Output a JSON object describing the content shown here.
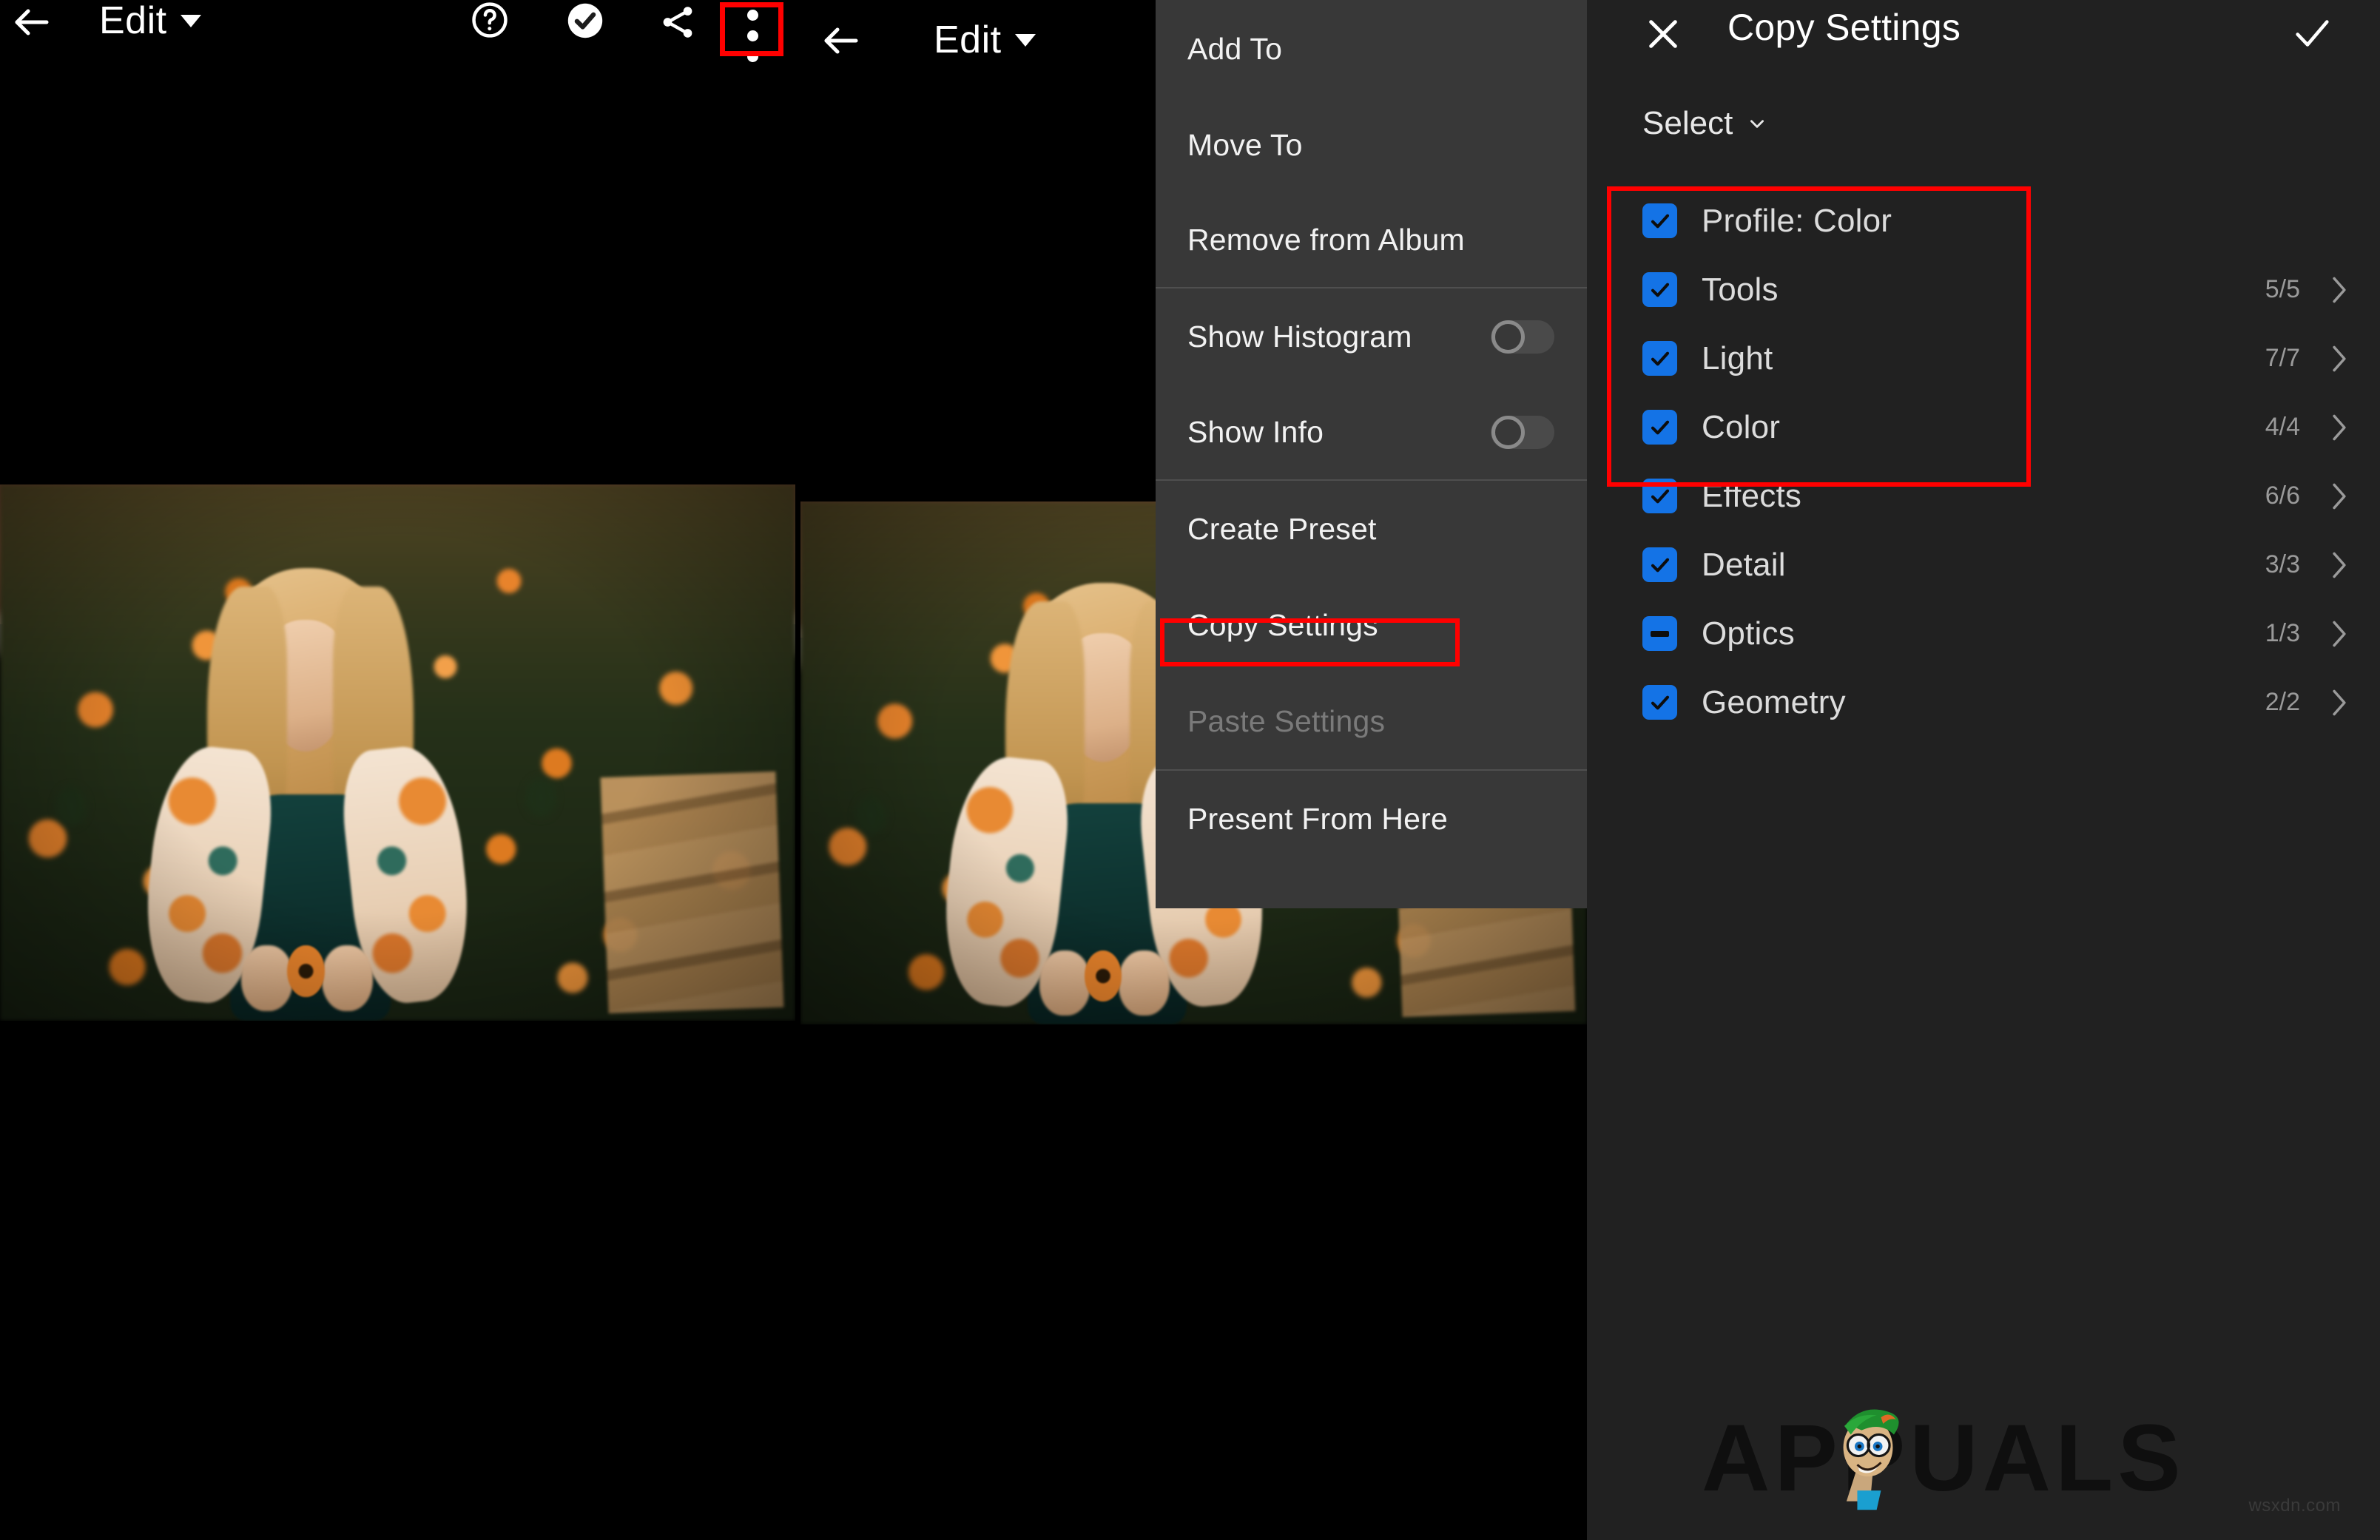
{
  "editor": {
    "back_icon": "back-arrow-icon",
    "title_primary": "Edit",
    "title_secondary": "Edit",
    "caret": "caret-down-icon",
    "toolbar": {
      "help_icon": "help-circle-icon",
      "check_icon": "check-circle-icon",
      "share_icon": "share-icon",
      "more_icon": "kebab-menu-icon"
    },
    "highlight_color": "#ff0000"
  },
  "overflow_menu": {
    "background": "#383838",
    "items": [
      {
        "label": "Add To",
        "type": "action",
        "disabled": false,
        "highlighted": false
      },
      {
        "label": "Move To",
        "type": "action",
        "disabled": false,
        "highlighted": false
      },
      {
        "label": "Remove from Album",
        "type": "action",
        "disabled": false,
        "highlighted": false
      },
      {
        "label": "Show Histogram",
        "type": "toggle",
        "value": "off",
        "disabled": false,
        "highlighted": false
      },
      {
        "label": "Show Info",
        "type": "toggle",
        "value": "off",
        "disabled": false,
        "highlighted": false
      },
      {
        "label": "Create Preset",
        "type": "action",
        "disabled": false,
        "highlighted": false
      },
      {
        "label": "Copy Settings",
        "type": "action",
        "disabled": false,
        "highlighted": true
      },
      {
        "label": "Paste Settings",
        "type": "action",
        "disabled": true,
        "highlighted": false
      },
      {
        "label": "Present From Here",
        "type": "action",
        "disabled": false,
        "highlighted": false
      }
    ]
  },
  "panel": {
    "close_icon": "close-icon",
    "title": "Copy Settings",
    "done_icon": "checkmark-icon",
    "select_label": "Select",
    "select_caret": "chevron-down-icon",
    "accent_color": "#1473e6",
    "background": "#212121",
    "settings": [
      {
        "label": "Profile: Color",
        "state": "checked",
        "count": "",
        "chevron": false
      },
      {
        "label": "Tools",
        "state": "checked",
        "count": "5/5",
        "chevron": true
      },
      {
        "label": "Light",
        "state": "checked",
        "count": "7/7",
        "chevron": true
      },
      {
        "label": "Color",
        "state": "checked",
        "count": "4/4",
        "chevron": true
      },
      {
        "label": "Effects",
        "state": "checked",
        "count": "6/6",
        "chevron": true
      },
      {
        "label": "Detail",
        "state": "checked",
        "count": "3/3",
        "chevron": true
      },
      {
        "label": "Optics",
        "state": "indeterminate",
        "count": "1/3",
        "chevron": true
      },
      {
        "label": "Geometry",
        "state": "checked",
        "count": "2/2",
        "chevron": true
      }
    ]
  },
  "watermark": {
    "text": "APPUALS",
    "url": "wsxdn.com"
  }
}
